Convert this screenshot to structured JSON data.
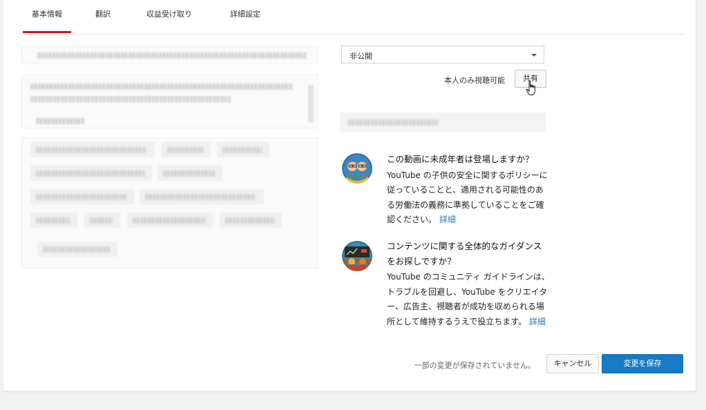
{
  "tabs": [
    {
      "label": "基本情報",
      "active": true
    },
    {
      "label": "翻訳",
      "active": false
    },
    {
      "label": "収益受け取り",
      "active": false
    },
    {
      "label": "詳細設定",
      "active": false
    }
  ],
  "privacy": {
    "selected": "非公開",
    "status_text": "本人のみ視聴可能",
    "share_label": "共有"
  },
  "info_minors": {
    "icon": "children-illustration-icon",
    "question": "この動画に未成年者は登場しますか？",
    "body": "YouTube の子供の安全に関するポリシーに従っていることと、適用される可能性のある労働法の義務に準拠していることをご確認ください。",
    "link": "詳細"
  },
  "info_guidance": {
    "icon": "community-guidelines-icon",
    "question": "コンテンツに関する全体的なガイダンスをお探しですか？",
    "body": "YouTube のコミュニティ ガイドラインは、トラブルを回避し、YouTube をクリエイター、広告主、視聴者が成功を収められる場所として維持するうえで役立ちます。",
    "link": "詳細"
  },
  "footer": {
    "unsaved_text": "一部の変更が保存されていません。",
    "cancel_label": "キャンセル",
    "save_label": "変更を保存"
  },
  "colors": {
    "accent_red": "#cc181e",
    "link_blue": "#167ac6",
    "save_blue": "#167ac6"
  }
}
